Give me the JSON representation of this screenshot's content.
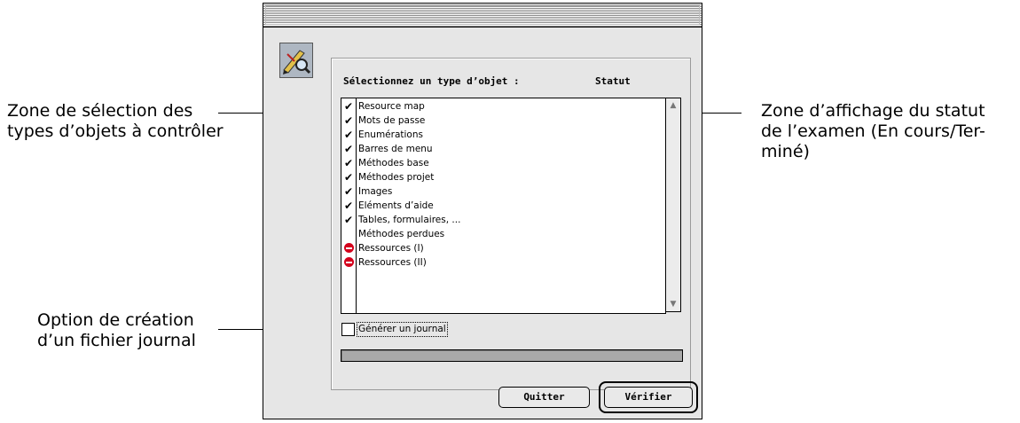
{
  "callouts": {
    "selection_zone": [
      "Zone de sélection des",
      "types d’objets à contrôler"
    ],
    "status_zone": [
      "Zone d’affichage du statut",
      "de l’examen (En cours/Ter-",
      "miné)"
    ],
    "log_option": [
      "Option de création",
      "d’un fichier journal"
    ]
  },
  "dialog": {
    "headers": {
      "select": "Sélectionnez un type d’objet :",
      "status": "Statut"
    },
    "items": [
      {
        "label": "Resource map",
        "state": "checked"
      },
      {
        "label": "Mots de passe",
        "state": "checked"
      },
      {
        "label": "Enumérations",
        "state": "checked"
      },
      {
        "label": "Barres de menu",
        "state": "checked"
      },
      {
        "label": "Méthodes base",
        "state": "checked"
      },
      {
        "label": "Méthodes projet",
        "state": "checked"
      },
      {
        "label": "Images",
        "state": "checked"
      },
      {
        "label": "Eléments d’aide",
        "state": "checked"
      },
      {
        "label": "Tables, formulaires, ...",
        "state": "checked"
      },
      {
        "label": "Méthodes perdues",
        "state": "none"
      },
      {
        "label": "Ressources (I)",
        "state": "stop"
      },
      {
        "label": "Ressources (II)",
        "state": "stop"
      }
    ],
    "log_checkbox_label": "Générer un journal",
    "log_checkbox_checked": false,
    "progress": 0,
    "buttons": {
      "quit": "Quitter",
      "verify": "Vérifier"
    }
  },
  "icons": {
    "check": "checkmark-icon",
    "stop": "stop-sign-icon",
    "app": "compact-tool-icon"
  },
  "colors": {
    "stop": "#d4001c",
    "window_bg": "#e6e6e6",
    "progress_bg": "#a9a9a9"
  }
}
